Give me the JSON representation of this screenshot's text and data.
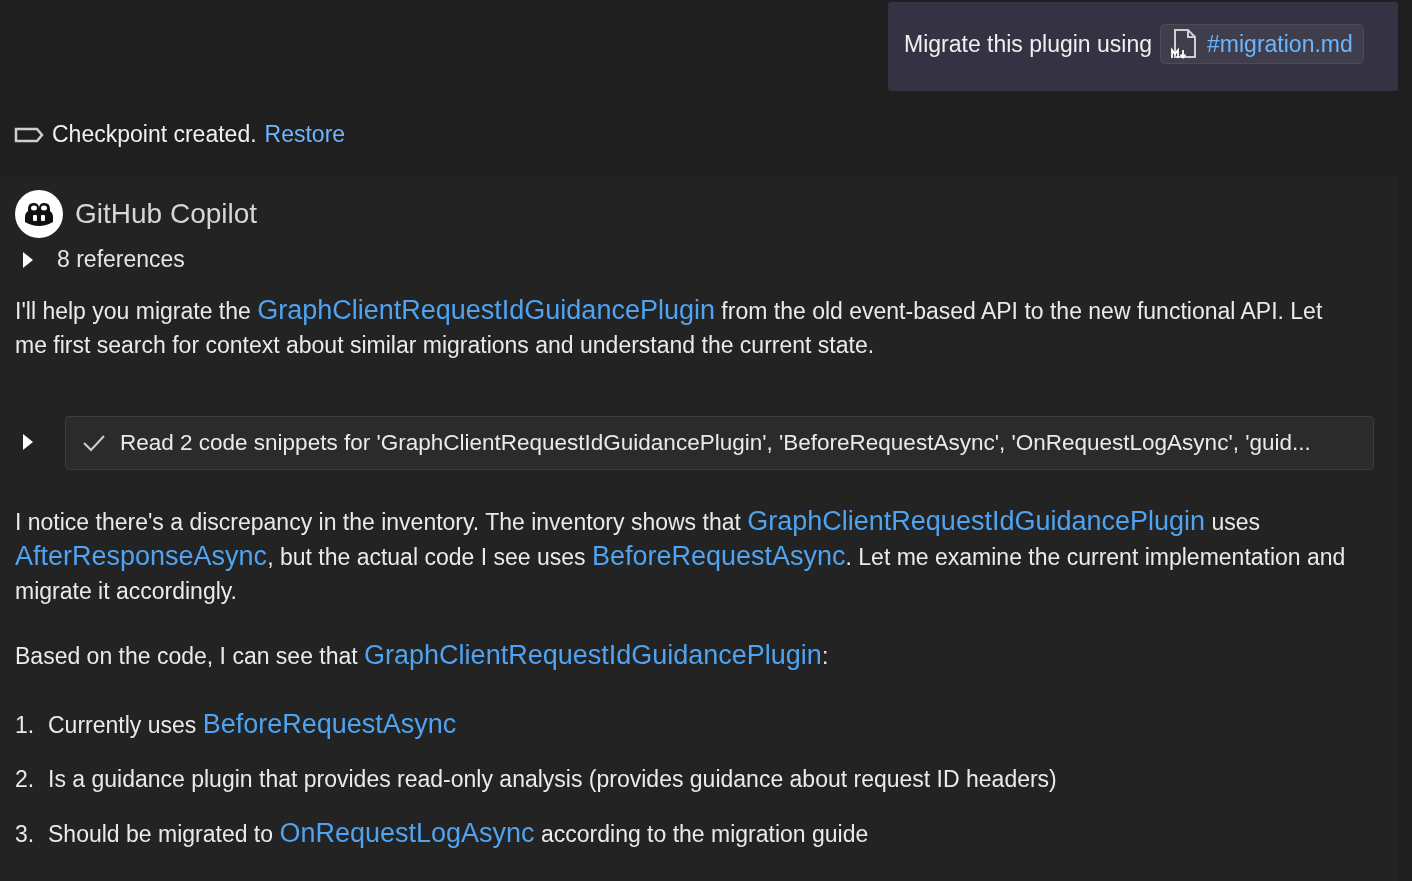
{
  "user_message": {
    "text": "Migrate this plugin using",
    "attachment": "#migration.md"
  },
  "checkpoint": {
    "text": "Checkpoint created.",
    "action": "Restore"
  },
  "response": {
    "author": "GitHub Copilot",
    "references": {
      "label": "8 references",
      "expanded": false
    },
    "blocks": [
      {
        "kind": "paragraph",
        "segments": [
          {
            "kind": "text",
            "text": "I'll help you migrate the "
          },
          {
            "kind": "link",
            "text": "GraphClientRequestIdGuidancePlugin"
          },
          {
            "kind": "text",
            "text": " from the old event-based API to the new functional API. Let me first search for context about similar migrations and understand the current state."
          }
        ]
      },
      {
        "kind": "tool",
        "expanded": false,
        "done": true,
        "text": "Read 2 code snippets for 'GraphClientRequestIdGuidancePlugin', 'BeforeRequestAsync', 'OnRequestLogAsync', 'guid..."
      },
      {
        "kind": "paragraph",
        "segments": [
          {
            "kind": "text",
            "text": "I notice there's a discrepancy in the inventory. The inventory shows that "
          },
          {
            "kind": "link",
            "text": "GraphClientRequestIdGuidancePlugin"
          },
          {
            "kind": "text",
            "text": " uses "
          },
          {
            "kind": "link",
            "text": "AfterResponseAsync"
          },
          {
            "kind": "text",
            "text": ", but the actual code I see uses "
          },
          {
            "kind": "link",
            "text": "BeforeRequestAsync"
          },
          {
            "kind": "text",
            "text": ". Let me examine the current implementation and migrate it accordingly."
          }
        ]
      },
      {
        "kind": "paragraph",
        "segments": [
          {
            "kind": "text",
            "text": "Based on the code, I can see that "
          },
          {
            "kind": "link",
            "text": "GraphClientRequestIdGuidancePlugin"
          },
          {
            "kind": "text",
            "text": ":"
          }
        ]
      },
      {
        "kind": "list",
        "items": [
          {
            "number": "1.",
            "segments": [
              {
                "kind": "text",
                "text": "Currently uses "
              },
              {
                "kind": "link",
                "text": "BeforeRequestAsync"
              }
            ]
          },
          {
            "number": "2.",
            "segments": [
              {
                "kind": "text",
                "text": "Is a guidance plugin that provides read-only analysis (provides guidance about request ID headers)"
              }
            ]
          },
          {
            "number": "3.",
            "segments": [
              {
                "kind": "text",
                "text": "Should be migrated to "
              },
              {
                "kind": "link",
                "text": "OnRequestLogAsync"
              },
              {
                "kind": "text",
                "text": " according to the migration guide"
              }
            ]
          }
        ]
      }
    ]
  }
}
